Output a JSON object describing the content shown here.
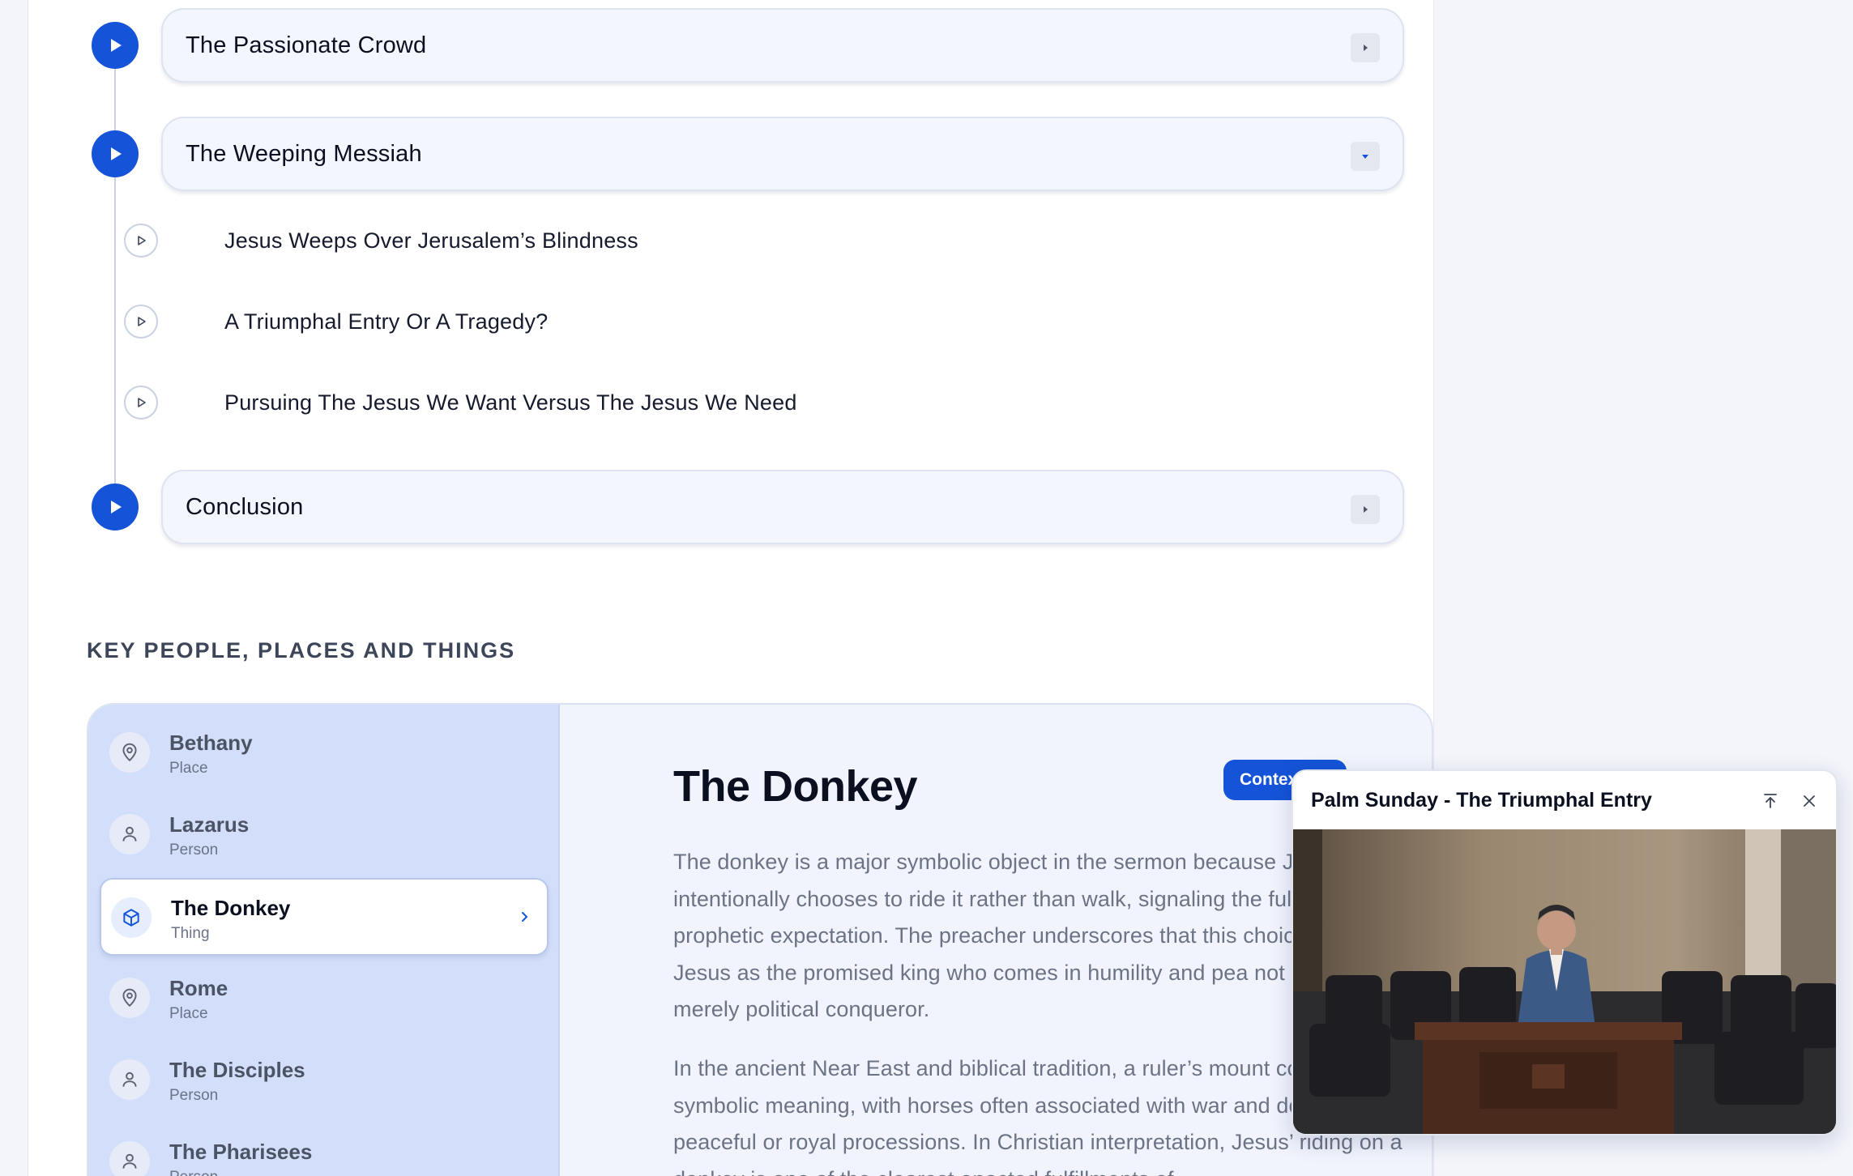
{
  "outline": {
    "sections": [
      {
        "title": "The Passionate Crowd",
        "expanded": false
      },
      {
        "title": "The Weeping Messiah",
        "expanded": true
      },
      {
        "title": "Conclusion",
        "expanded": false
      }
    ],
    "subsections": [
      "Jesus Weeps Over Jerusalem’s Blindness",
      "A Triumphal Entry Or A Tragedy?",
      "Pursuing The Jesus We Want Versus The Jesus We Need"
    ]
  },
  "key_people": {
    "heading": "KEY PEOPLE, PLACES AND THINGS",
    "items": [
      {
        "name": "Bethany",
        "type": "Place",
        "icon": "map-pin-icon"
      },
      {
        "name": "Lazarus",
        "type": "Person",
        "icon": "person-icon"
      },
      {
        "name": "The Donkey",
        "type": "Thing",
        "icon": "cube-icon",
        "active": true
      },
      {
        "name": "Rome",
        "type": "Place",
        "icon": "map-pin-icon"
      },
      {
        "name": "The Disciples",
        "type": "Person",
        "icon": "person-icon"
      },
      {
        "name": "The Pharisees",
        "type": "Person",
        "icon": "person-icon"
      }
    ],
    "detail": {
      "title": "The Donkey",
      "context_button": "Contex",
      "paragraphs": [
        "The donkey is a major symbolic object in the sermon because Jesus intentionally chooses to ride it rather than walk, signaling the fulfillm of prophetic expectation. The preacher underscores that this choice identified Jesus as the promised king who comes in humility and pea not as a merely political conqueror.",
        "In the ancient Near East and biblical tradition, a ruler’s mount could c symbolic meaning, with horses often associated with war and donke with peaceful or royal processions. In Christian interpretation, Jesus’ riding on a donkey is one of the clearest enacted fulfillments of"
      ]
    }
  },
  "video": {
    "title": "Palm Sunday - The Triumphal Entry",
    "colors": {
      "accent": "#1554d8"
    }
  }
}
